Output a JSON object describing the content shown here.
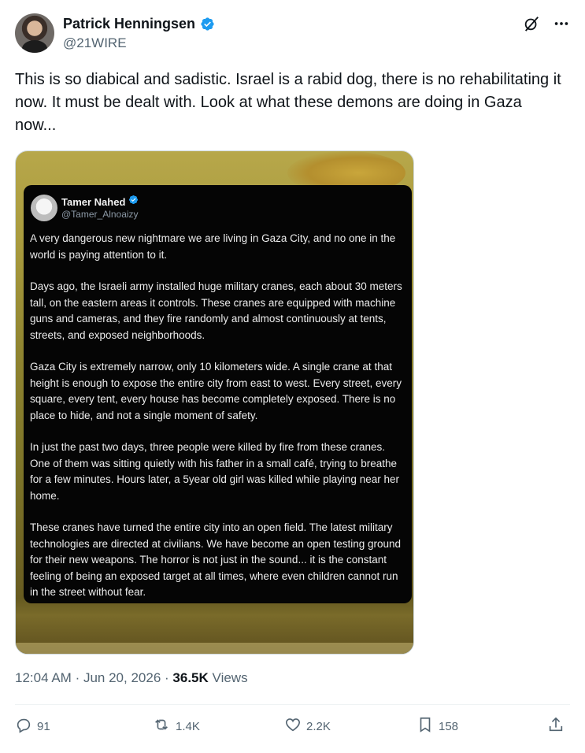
{
  "author": {
    "display_name": "Patrick Henningsen",
    "handle": "@21WIRE"
  },
  "tweet_text": "This is so diabical and sadistic. Israel is a rabid dog, there is no rehabilitating it now. It must be dealt with. Look at what these demons are doing in Gaza now...",
  "icons": {
    "verified": "verified-badge-icon",
    "grok": "grok-icon",
    "more": "more-icon",
    "reply": "reply-icon",
    "repost": "repost-icon",
    "like": "like-icon",
    "bookmark": "bookmark-icon",
    "share": "share-icon"
  },
  "colors": {
    "verified_blue": "#1d9bf0",
    "secondary_text": "#536471"
  },
  "embedded_post": {
    "display_name": "Tamer Nahed",
    "handle": "@Tamer_Alnoaizy",
    "paragraphs": [
      "A very dangerous new nightmare we are living in Gaza City, and no one in the world is paying attention to it.",
      "Days ago, the Israeli army installed huge military cranes, each about 30 meters tall, on the eastern areas it controls. These cranes are equipped with machine guns and cameras, and they fire randomly and almost continuously at tents, streets, and exposed neighborhoods.",
      "Gaza City is extremely narrow, only 10 kilometers wide. A single crane at that height is enough to expose the entire city from east to west. Every street, every square, every tent, every house has become completely exposed. There is no place to hide, and not a single moment of safety.",
      "In just the past two days, three people were killed by fire from these cranes. One of them was sitting quietly with his father in a small café, trying to breathe for a few minutes. Hours later, a 5year old girl was killed while playing near her home.",
      "These cranes have turned the entire city into an open field. The latest military technologies are directed at civilians. We have become an open testing ground for their new weapons. The horror is not just in the sound... it is the constant feeling of being an exposed target at all times, where even children cannot run in the street without fear."
    ]
  },
  "meta": {
    "time": "12:04 AM",
    "separator": "·",
    "date": "Jun 20, 2026",
    "views_count": "36.5K",
    "views_label": "Views"
  },
  "actions": {
    "replies": "91",
    "reposts": "1.4K",
    "likes": "2.2K",
    "bookmarks": "158"
  }
}
